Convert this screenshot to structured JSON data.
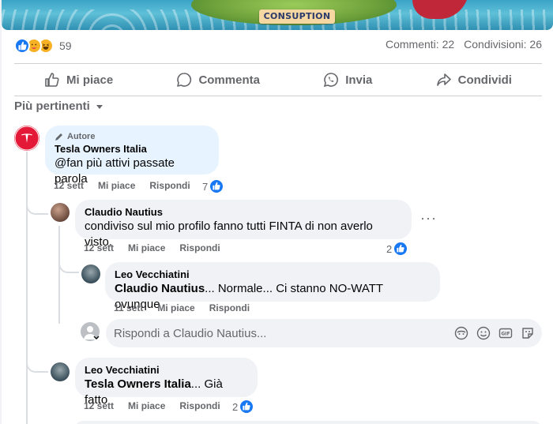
{
  "banner": {
    "caption": "CONSUPTION"
  },
  "reactions": {
    "icons": [
      "like-icon",
      "care-icon",
      "haha-icon"
    ],
    "count": "59"
  },
  "stats": {
    "comments": "Commenti: 22",
    "shares": "Condivisioni: 26"
  },
  "actions": {
    "like": "Mi piace",
    "comment": "Commenta",
    "send": "Invia",
    "share": "Condividi"
  },
  "sort": {
    "label": "Più pertinenti"
  },
  "comments": [
    {
      "author_tag": "Autore",
      "name": "Tesla Owners Italia",
      "text": "@fan più attivi passate parola",
      "time": "12 sett",
      "like": "Mi piace",
      "reply": "Rispondi",
      "likes": "7"
    },
    {
      "name": "Claudio Nautius",
      "text": "condiviso sul mio profilo fanno tutti FINTA di non averlo visto.",
      "time": "12 sett",
      "like": "Mi piace",
      "reply": "Rispondi",
      "likes": "2",
      "more": "···"
    },
    {
      "name": "Leo Vecchiatini",
      "mention": "Claudio Nautius",
      "text": "... Normale... Ci stanno NO-WATT ovunque",
      "time": "11 sett",
      "like": "Mi piace",
      "reply": "Rispondi"
    },
    {
      "name": "Leo Vecchiatini",
      "mention": "Tesla Owners Italia",
      "text": "... Già fatto",
      "time": "12 sett",
      "like": "Mi piace",
      "reply": "Rispondi",
      "likes": "2"
    }
  ],
  "reply_input": {
    "placeholder": "Rispondi a Claudio Nautius..."
  },
  "colors": {
    "brand": "#1877f2",
    "author_bubble": "#e7f3ff",
    "bubble": "#f0f2f5",
    "muted": "#65676b",
    "tesla_red": "#e31937"
  }
}
